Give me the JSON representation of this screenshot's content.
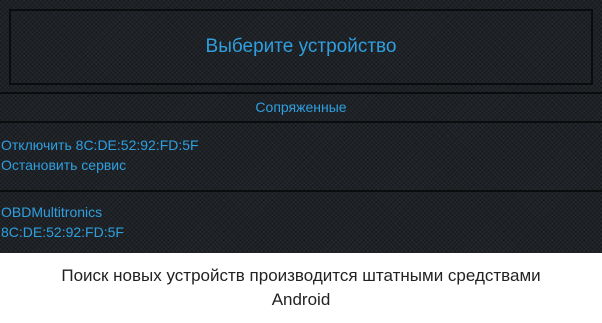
{
  "dialog": {
    "title": "Выберите устройство",
    "section_label": "Сопряженные",
    "actions": {
      "disconnect": "Отключить 8C:DE:52:92:FD:5F",
      "stop_service": "Остановить сервис"
    },
    "device": {
      "name": "OBDMultitronics",
      "address": "8C:DE:52:92:FD:5F"
    }
  },
  "footer": {
    "message": "Поиск новых устройств производится штатными средствами Android"
  },
  "colors": {
    "accent": "#2f9fe0",
    "dialog_bg": "#1e2226",
    "divider": "#0a0c0e",
    "footer_bg": "#ffffff",
    "footer_text": "#222222"
  }
}
